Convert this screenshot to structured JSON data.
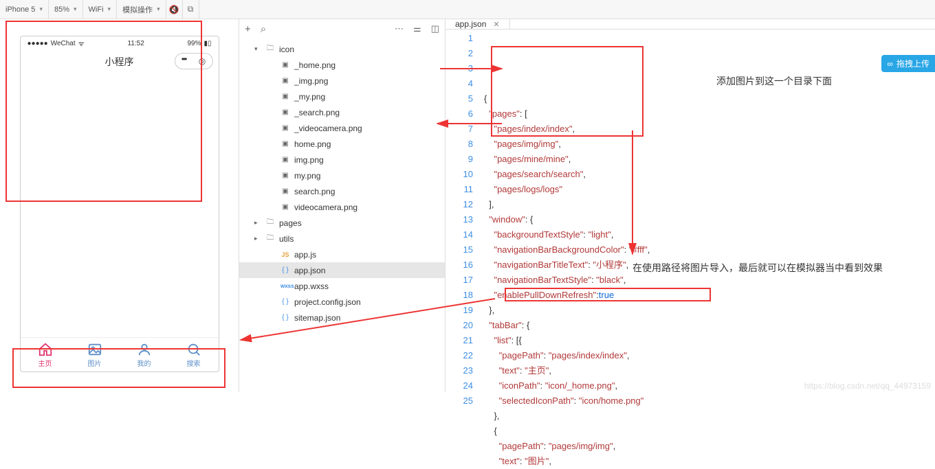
{
  "toolbar": {
    "device": "iPhone 5",
    "zoom": "85%",
    "network": "WiFi",
    "mock": "模拟操作"
  },
  "simulator": {
    "carrier": "WeChat",
    "time": "11:52",
    "battery": "99%",
    "navTitle": "小程序",
    "tabs": [
      {
        "label": "主页",
        "active": true
      },
      {
        "label": "图片",
        "active": false
      },
      {
        "label": "我的",
        "active": false
      },
      {
        "label": "搜索",
        "active": false
      }
    ]
  },
  "tree": {
    "iconFolder": "icon",
    "iconFiles": [
      "_home.png",
      "_img.png",
      "_my.png",
      "_search.png",
      "_videocamera.png",
      "home.png",
      "img.png",
      "my.png",
      "search.png",
      "videocamera.png"
    ],
    "pagesFolder": "pages",
    "utilsFolder": "utils",
    "rootFiles": [
      {
        "name": "app.js",
        "type": "js"
      },
      {
        "name": "app.json",
        "type": "json",
        "selected": true
      },
      {
        "name": "app.wxss",
        "type": "wxss"
      },
      {
        "name": "project.config.json",
        "type": "json"
      },
      {
        "name": "sitemap.json",
        "type": "json"
      }
    ]
  },
  "editor": {
    "tabName": "app.json",
    "lines": [
      {
        "n": 1,
        "html": "<span class='pun'>{</span>"
      },
      {
        "n": 2,
        "html": "  <span class='key'>\"pages\"</span><span class='pun'>: [</span>"
      },
      {
        "n": 3,
        "html": "    <span class='str'>\"pages/index/index\"</span><span class='pun'>,</span>"
      },
      {
        "n": 4,
        "html": "    <span class='str'>\"pages/img/img\"</span><span class='pun'>,</span>"
      },
      {
        "n": 5,
        "html": "    <span class='str'>\"pages/mine/mine\"</span><span class='pun'>,</span>"
      },
      {
        "n": 6,
        "html": "    <span class='str'>\"pages/search/search\"</span><span class='pun'>,</span>"
      },
      {
        "n": 7,
        "html": "    <span class='str'>\"pages/logs/logs\"</span>"
      },
      {
        "n": 8,
        "html": "  <span class='pun'>],</span>"
      },
      {
        "n": 9,
        "html": "  <span class='key'>\"window\"</span><span class='pun'>: {</span>"
      },
      {
        "n": 10,
        "html": "    <span class='key'>\"backgroundTextStyle\"</span><span class='pun'>: </span><span class='str'>\"light\"</span><span class='pun'>,</span>"
      },
      {
        "n": 11,
        "html": "    <span class='key'>\"navigationBarBackgroundColor\"</span><span class='pun'>: </span><span class='str'>\"#fff\"</span><span class='pun'>,</span>"
      },
      {
        "n": 12,
        "html": "    <span class='key'>\"navigationBarTitleText\"</span><span class='pun'>: </span><span class='str'>\"小程序\"</span><span class='pun'>,</span>"
      },
      {
        "n": 13,
        "html": "    <span class='key'>\"navigationBarTextStyle\"</span><span class='pun'>: </span><span class='str'>\"black\"</span><span class='pun'>,</span>"
      },
      {
        "n": 14,
        "html": "    <span class='key'>\"enablePullDownRefresh\"</span><span class='pun'>:</span><span class='kw'>true</span>"
      },
      {
        "n": 15,
        "html": "  <span class='pun'>},</span>"
      },
      {
        "n": 16,
        "html": "  <span class='key'>\"tabBar\"</span><span class='pun'>: {</span>"
      },
      {
        "n": 17,
        "html": "    <span class='key'>\"list\"</span><span class='pun'>: [{</span>"
      },
      {
        "n": 18,
        "html": "      <span class='key'>\"pagePath\"</span><span class='pun'>: </span><span class='str'>\"pages/index/index\"</span><span class='pun'>,</span>"
      },
      {
        "n": 19,
        "html": "      <span class='key'>\"text\"</span><span class='pun'>: </span><span class='str'>\"主页\"</span><span class='pun'>,</span>"
      },
      {
        "n": 20,
        "html": "      <span class='key'>\"iconPath\"</span><span class='pun'>: </span><span class='str'>\"icon/_home.png\"</span><span class='pun'>,</span>"
      },
      {
        "n": 21,
        "html": "      <span class='key'>\"selectedIconPath\"</span><span class='pun'>: </span><span class='str'>\"icon/home.png\"</span>"
      },
      {
        "n": 22,
        "html": "    <span class='pun'>},</span>"
      },
      {
        "n": 23,
        "html": "    <span class='pun'>{</span>"
      },
      {
        "n": 24,
        "html": "      <span class='key'>\"pagePath\"</span><span class='pun'>: </span><span class='str'>\"pages/img/img\"</span><span class='pun'>,</span>"
      },
      {
        "n": 25,
        "html": "      <span class='key'>\"text\"</span><span class='pun'>: </span><span class='str'>\"图片\"</span><span class='pun'>,</span>"
      }
    ]
  },
  "annotations": {
    "a1": "添加图片到这一个目录下面",
    "a2": "在使用路径将图片导入，最后就可以在模拟器当中看到效果"
  },
  "upload": "拖拽上传",
  "watermark": "https://blog.csdn.net/qq_44973159"
}
